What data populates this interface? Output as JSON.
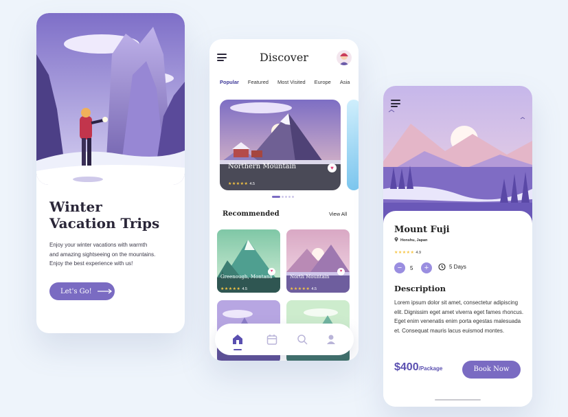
{
  "card1": {
    "title_line1": "Winter",
    "title_line2": "Vacation Trips",
    "desc_line1": "Enjoy your winter vacations with warmth",
    "desc_line2": "and amazing sightseeing on the mountains.",
    "desc_line3": "Enjoy the best experience with us!",
    "cta_label": "Let's Go!"
  },
  "discover": {
    "title": "Discover",
    "tabs": [
      "Popular",
      "Featured",
      "Most Visited",
      "Europe",
      "Asia"
    ],
    "featured": {
      "name": "Northern Mountain",
      "rating": "4.5"
    },
    "recommended_label": "Recommended",
    "view_all": "View All",
    "tiles": [
      {
        "name": "Greenough, Montana",
        "rating": "4.5"
      },
      {
        "name": "North Mountain",
        "rating": "4.5"
      }
    ]
  },
  "detail": {
    "name": "Mount Fuji",
    "location": "Honshu, Japan",
    "rating": "4.9",
    "quantity": "5",
    "days": "5 Days",
    "description_title": "Description",
    "description": "Lorem ipsum dolor sit amet, consectetur adipiscing elit. Dignissim eget amet viverra eget fames rhoncus. Eget enim venenatis enim porta egestas malesuada et. Consequat mauris lacus euismod montes.",
    "price": "$400",
    "price_unit": "/Package",
    "book_label": "Book Now"
  },
  "icons": {
    "star": "★★★★★"
  },
  "colors": {
    "accent": "#7a6bc2",
    "background": "#eef4fb"
  }
}
